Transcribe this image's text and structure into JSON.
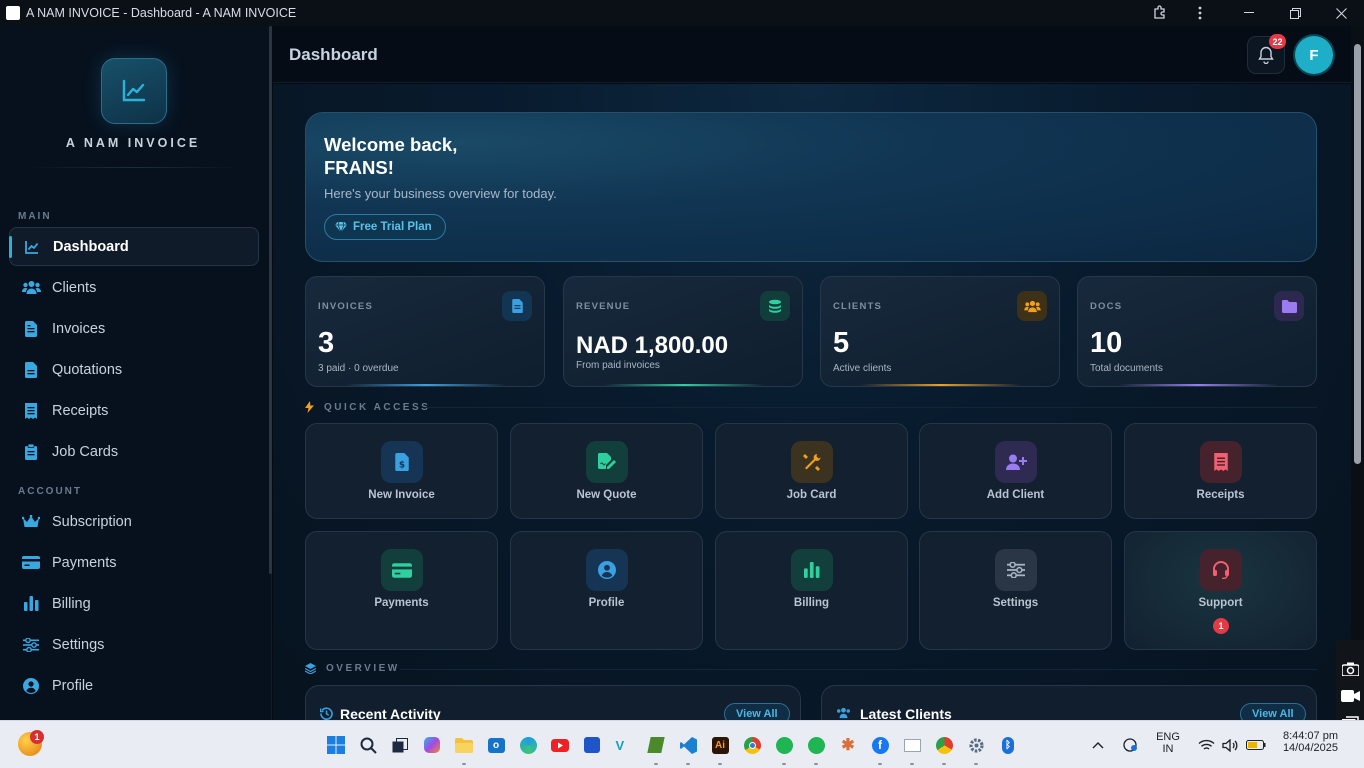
{
  "window": {
    "title": "A NAM INVOICE - Dashboard - A NAM INVOICE"
  },
  "brand": {
    "name": "A NAM INVOICE",
    "accent": "#2ab3d6"
  },
  "sidebar": {
    "main_label": "MAIN",
    "account_label": "ACCOUNT",
    "main_items": [
      {
        "label": "Dashboard",
        "icon": "chart-line-icon",
        "active": true
      },
      {
        "label": "Clients",
        "icon": "users-icon"
      },
      {
        "label": "Invoices",
        "icon": "file-invoice-icon"
      },
      {
        "label": "Quotations",
        "icon": "file-icon"
      },
      {
        "label": "Receipts",
        "icon": "receipt-icon"
      },
      {
        "label": "Job Cards",
        "icon": "clipboard-icon"
      }
    ],
    "account_items": [
      {
        "label": "Subscription",
        "icon": "crown-icon"
      },
      {
        "label": "Payments",
        "icon": "credit-card-icon"
      },
      {
        "label": "Billing",
        "icon": "bar-chart-icon"
      },
      {
        "label": "Settings",
        "icon": "sliders-icon"
      },
      {
        "label": "Profile",
        "icon": "user-circle-icon"
      }
    ]
  },
  "header": {
    "title": "Dashboard",
    "notification_count": "22",
    "avatar_initial": "F"
  },
  "welcome": {
    "line1": "Welcome back,",
    "line2": "FRANS!",
    "subtitle": "Here's your business overview for today.",
    "plan": "Free Trial Plan"
  },
  "stats": [
    {
      "label": "INVOICES",
      "value": "3",
      "sub": "3 paid · 0 overdue",
      "icon": "file-invoice-icon",
      "color": "#3aa0e0"
    },
    {
      "label": "REVENUE",
      "value": "NAD 1,800.00",
      "sub": "From paid invoices",
      "icon": "coins-icon",
      "color": "#2fd0a0"
    },
    {
      "label": "CLIENTS",
      "value": "5",
      "sub": "Active clients",
      "icon": "users-icon",
      "color": "#f0a020"
    },
    {
      "label": "DOCS",
      "value": "10",
      "sub": "Total documents",
      "icon": "folder-icon",
      "color": "#9a7cf0"
    }
  ],
  "quick_access": {
    "label": "QUICK ACCESS",
    "items": [
      {
        "label": "New Invoice",
        "icon": "file-invoice-dollar-icon",
        "color": "#3aa0e0"
      },
      {
        "label": "New Quote",
        "icon": "file-signature-icon",
        "color": "#2fd0a0"
      },
      {
        "label": "Job Card",
        "icon": "tools-icon",
        "color": "#f0a020"
      },
      {
        "label": "Add Client",
        "icon": "user-plus-icon",
        "color": "#9a7cf0"
      },
      {
        "label": "Receipts",
        "icon": "receipt-icon",
        "color": "#f06070"
      },
      {
        "label": "Payments",
        "icon": "credit-card-icon",
        "color": "#2fd0a0"
      },
      {
        "label": "Profile",
        "icon": "user-circle-icon",
        "color": "#3aa0e0"
      },
      {
        "label": "Billing",
        "icon": "bar-chart-icon",
        "color": "#2fd0a0"
      },
      {
        "label": "Settings",
        "icon": "sliders-icon",
        "color": "#a7b3c2"
      },
      {
        "label": "Support",
        "icon": "headset-icon",
        "color": "#f06070",
        "badge": "1"
      }
    ]
  },
  "overview": {
    "label": "OVERVIEW",
    "recent_activity": {
      "title": "Recent Activity",
      "action": "View All"
    },
    "latest_clients": {
      "title": "Latest Clients",
      "action": "View All"
    }
  },
  "taskbar": {
    "lang_line1": "ENG",
    "lang_line2": "IN",
    "time": "8:44:07 pm",
    "date": "14/04/2025",
    "start_badge": "1"
  }
}
